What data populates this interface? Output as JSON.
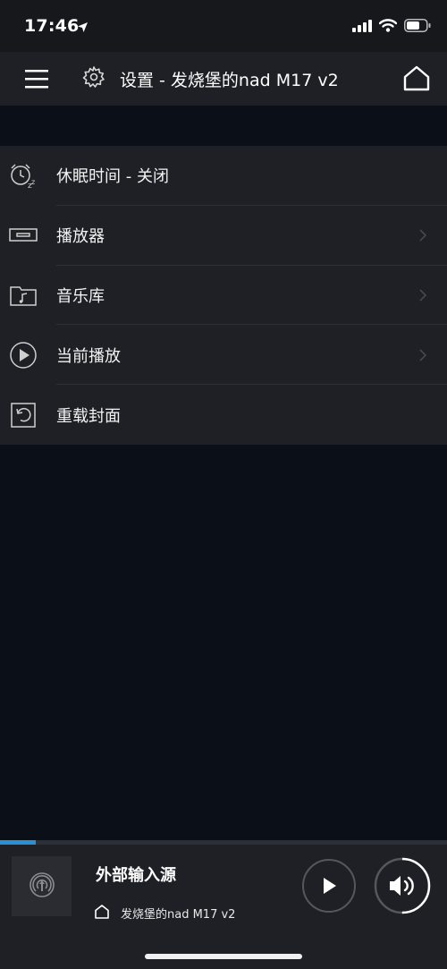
{
  "status_bar": {
    "time": "17:46",
    "icons": [
      "location-arrow-icon",
      "cellular-signal-icon",
      "wifi-icon",
      "battery-icon"
    ]
  },
  "nav_bar": {
    "title": "设置 - 发烧堡的nad M17 v2",
    "icons": [
      "menu-icon",
      "gear-icon",
      "home-icon"
    ]
  },
  "menu": {
    "items": [
      {
        "label": "休眠时间 - 关闭",
        "icon": "alarm-clock-sleep-icon",
        "has_chevron": false
      },
      {
        "label": "播放器",
        "icon": "player-device-icon",
        "has_chevron": true
      },
      {
        "label": "音乐库",
        "icon": "music-folder-icon",
        "has_chevron": true
      },
      {
        "label": "当前播放",
        "icon": "play-circle-icon",
        "has_chevron": true
      },
      {
        "label": "重载封面",
        "icon": "reload-cover-icon",
        "has_chevron": false
      }
    ]
  },
  "player": {
    "track_title": "外部输入源",
    "device_name": "发烧堡的nad M17 v2",
    "progress_fraction": 0.08,
    "volume_fraction": 0.5,
    "accent_color": "#2b8fd6",
    "icons": [
      "input-source-icon",
      "home-small-icon",
      "play-icon",
      "volume-icon"
    ]
  }
}
